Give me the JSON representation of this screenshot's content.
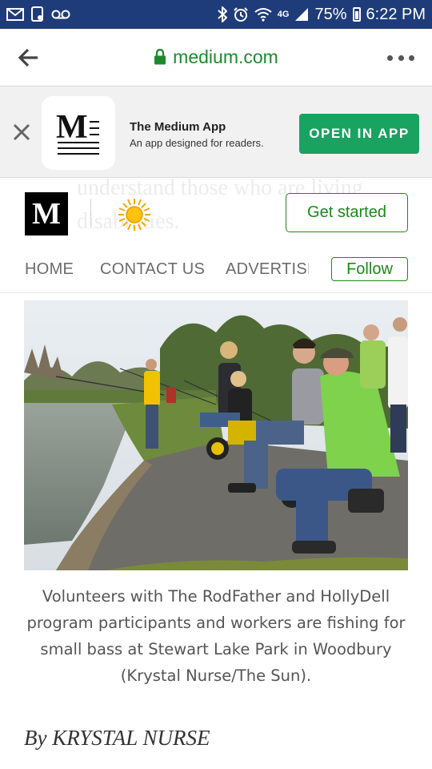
{
  "status_bar": {
    "network": "4G",
    "battery": "75%",
    "time": "6:22 PM"
  },
  "browser": {
    "url": "medium.com"
  },
  "app_banner": {
    "app_name": "The Medium App",
    "description": "An app designed for readers.",
    "open_button": "OPEN IN APP"
  },
  "site_header": {
    "logo_letter": "M",
    "banner_icon_letter": "M",
    "ghost_text_line1": "understand those who are living",
    "ghost_text_line2": "disabilities.",
    "get_started": "Get started"
  },
  "nav": {
    "home": "HOME",
    "contact": "CONTACT US",
    "advertise": "ADVERTISE",
    "follow": "Follow"
  },
  "article": {
    "caption": "Volunteers with The RodFather and HollyDell program participants and workers are fishing for small bass at Stewart Lake Park in Woodbury (Krystal Nurse/The Sun).",
    "byline": "By KRYSTAL NURSE"
  },
  "colors": {
    "status_bar_bg": "#1f3c7a",
    "url_green": "#1e8a2f",
    "open_app_green": "#1aa260",
    "medium_green": "#1a8917"
  },
  "icons": [
    "mail-icon",
    "screenshot-icon",
    "voicemail-icon",
    "bluetooth-icon",
    "alarm-icon",
    "wifi-icon",
    "signal-icon",
    "battery-icon",
    "back-arrow-icon",
    "lock-icon",
    "more-icon",
    "close-icon",
    "sun-logo-icon"
  ]
}
